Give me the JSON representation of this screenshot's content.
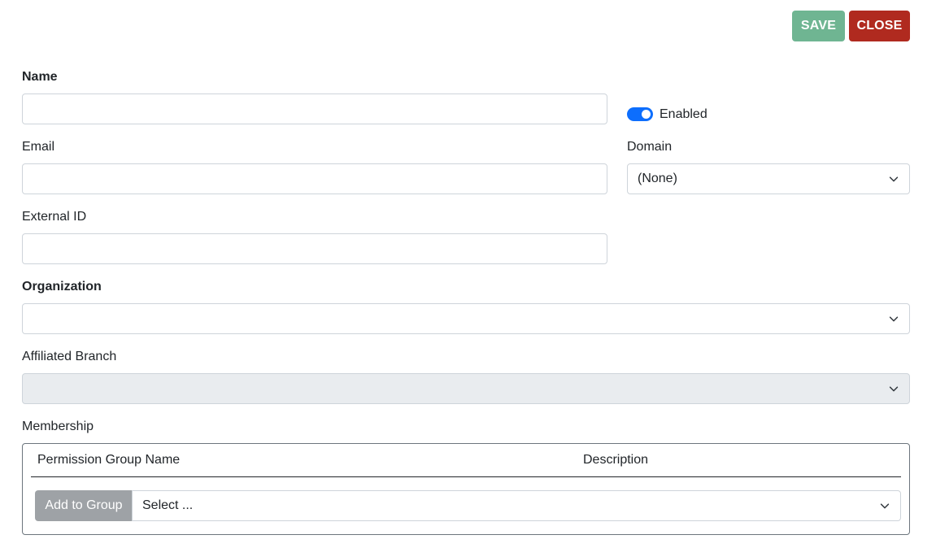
{
  "toolbar": {
    "save_label": "SAVE",
    "close_label": "CLOSE"
  },
  "form": {
    "name": {
      "label": "Name",
      "value": ""
    },
    "enabled": {
      "label": "Enabled",
      "checked": true
    },
    "email": {
      "label": "Email",
      "value": ""
    },
    "domain": {
      "label": "Domain",
      "selected": "(None)"
    },
    "external_id": {
      "label": "External ID",
      "value": ""
    },
    "organization": {
      "label": "Organization",
      "selected": ""
    },
    "affiliated_branch": {
      "label": "Affiliated Branch",
      "selected": "",
      "disabled": true
    },
    "membership": {
      "label": "Membership",
      "columns": [
        "Permission Group Name",
        "Description"
      ],
      "add_button_label": "Add to Group",
      "group_select_placeholder": "Select ..."
    }
  },
  "colors": {
    "save_bg": "#6fb592",
    "close_bg": "#b02a1f",
    "toggle_on": "#0d6efd",
    "disabled_bg": "#e9ecef",
    "add_button_bg": "#9ea2a6"
  },
  "icons": {
    "select_chevron": "chevron-down-icon"
  }
}
